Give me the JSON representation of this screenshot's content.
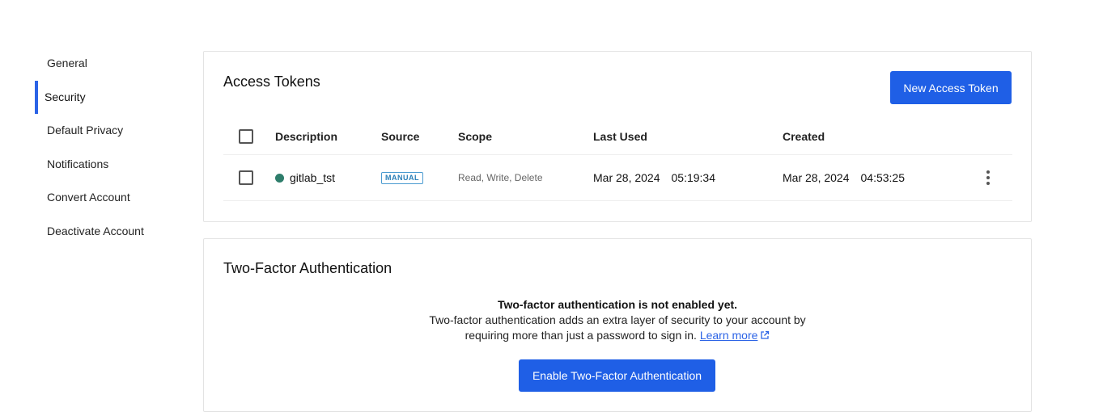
{
  "sidebar": {
    "items": [
      {
        "label": "General"
      },
      {
        "label": "Security",
        "active": true
      },
      {
        "label": "Default Privacy"
      },
      {
        "label": "Notifications"
      },
      {
        "label": "Convert Account"
      },
      {
        "label": "Deactivate Account"
      }
    ]
  },
  "access_tokens": {
    "title": "Access Tokens",
    "new_button_label": "New Access Token",
    "columns": {
      "description": "Description",
      "source": "Source",
      "scope": "Scope",
      "last_used": "Last Used",
      "created": "Created"
    },
    "rows": [
      {
        "description": "gitlab_tst",
        "status_color": "#2e7d6b",
        "source": "MANUAL",
        "scope": "Read, Write, Delete",
        "last_used_date": "Mar 28, 2024",
        "last_used_time": "05:19:34",
        "created_date": "Mar 28, 2024",
        "created_time": "04:53:25"
      }
    ]
  },
  "two_factor": {
    "title": "Two-Factor Authentication",
    "status": "Two-factor authentication is not enabled yet.",
    "description": "Two-factor authentication adds an extra layer of security to your account by requiring more than just a password to sign in.",
    "learn_more": "Learn more",
    "enable_button_label": "Enable Two-Factor Authentication"
  },
  "colors": {
    "primary": "#1f5fe6",
    "active_indicator": "#2b63e6",
    "badge": "#2a7fb8"
  }
}
